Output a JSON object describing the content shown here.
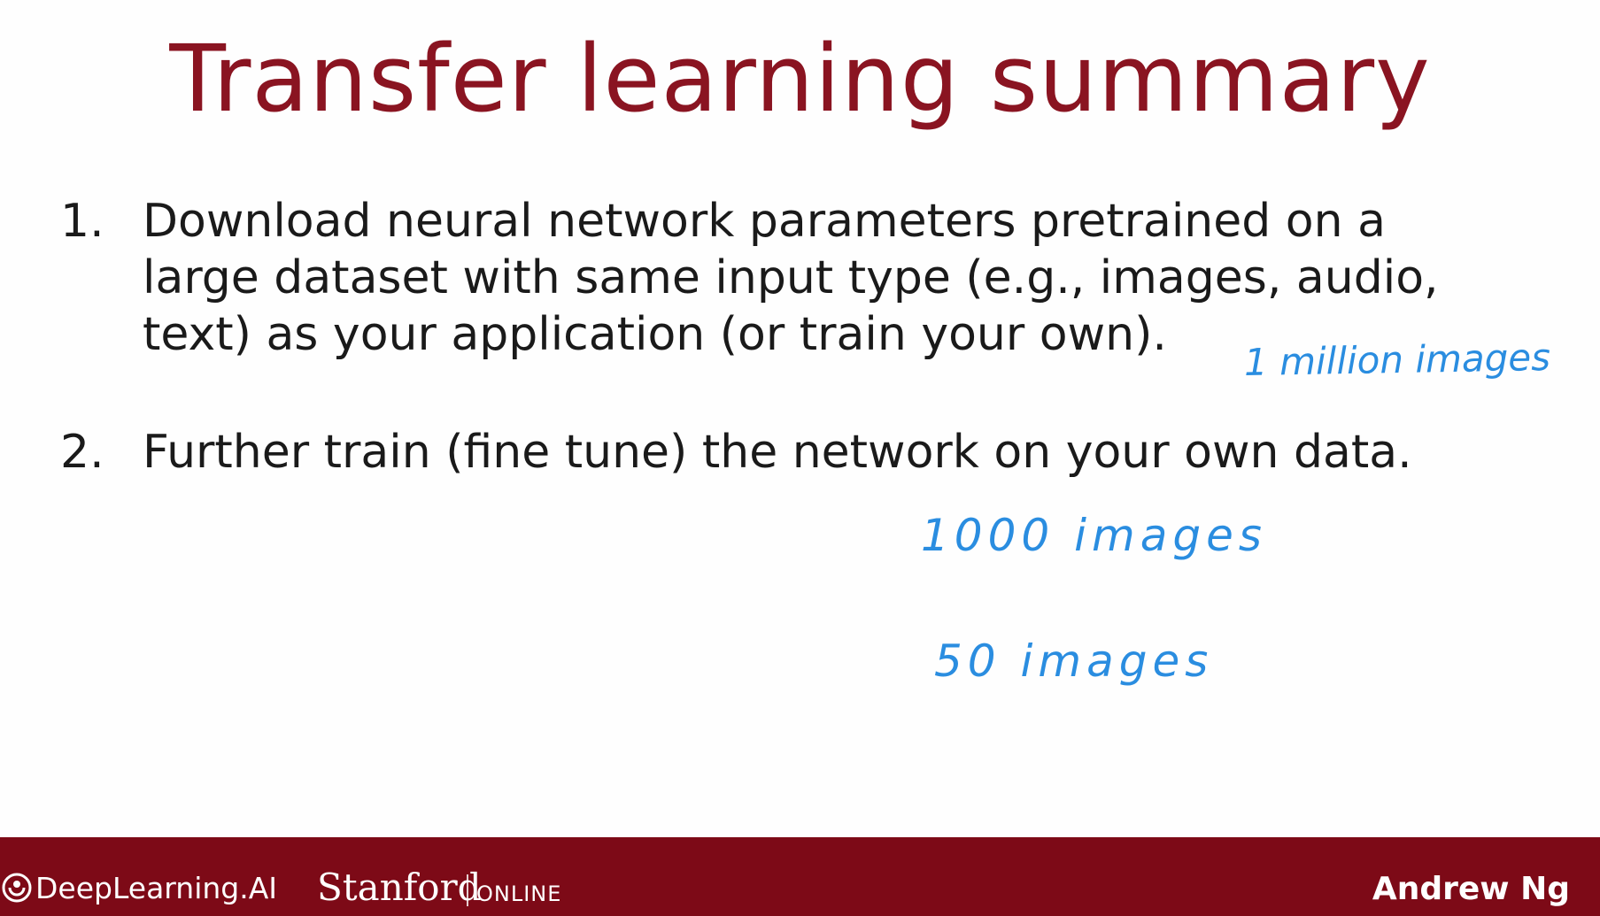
{
  "slide": {
    "title": "Transfer learning summary",
    "items": [
      {
        "number": "1.",
        "text": "Download neural network parameters pretrained on a\nlarge dataset with same input type (e.g., images, audio,\ntext) as your application (or train your own)."
      },
      {
        "number": "2.",
        "text": "Further train (fine tune) the network on your own data."
      }
    ],
    "annotations": {
      "million": "1 million images",
      "thousand": "1000 images",
      "fifty": "50 images"
    }
  },
  "footer": {
    "deeplearning_label": "DeepLearning.AI",
    "stanford_label": "Stanford",
    "online_label": "ONLINE",
    "author": "Andrew Ng",
    "logo_icon": "deeplearning-ai-logo-icon",
    "background_color": "#7d0a17"
  },
  "colors": {
    "title": "#8a1421",
    "body_text": "#1a1a1a",
    "annotation": "#2a8de0"
  }
}
